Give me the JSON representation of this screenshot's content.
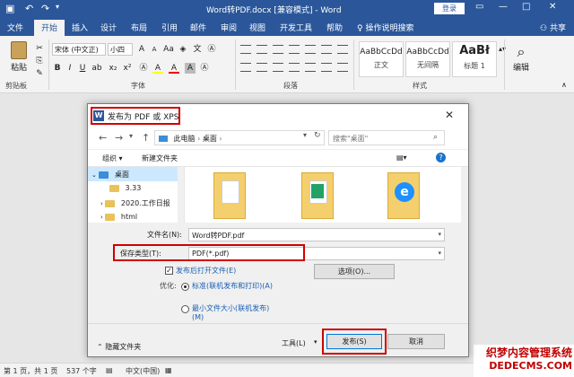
{
  "titlebar": {
    "title": "Word转PDF.docx [兼容模式] - Word",
    "login": "登录",
    "save_icon": "save-icon",
    "undo_icon": "undo-icon",
    "redo_icon": "redo-icon"
  },
  "tabs": [
    "文件",
    "开始",
    "插入",
    "设计",
    "布局",
    "引用",
    "邮件",
    "审阅",
    "视图",
    "开发工具",
    "帮助"
  ],
  "tell_me": "操作说明搜索",
  "share": "共享",
  "ribbon": {
    "paste": "粘贴",
    "clipboard_group": "剪贴板",
    "font_name": "宋体 (中文正)",
    "font_size": "小四",
    "font_group": "字体",
    "paragraph_group": "段落",
    "styles_group": "样式",
    "styles": [
      {
        "sample": "AaBbCcDd",
        "name": "正文"
      },
      {
        "sample": "AaBbCcDd",
        "name": "无间隔"
      },
      {
        "sample": "AaBł",
        "name": "标题 1"
      }
    ],
    "edit": "编辑",
    "bold": "B",
    "italic": "I",
    "underline": "U",
    "font_color": "A",
    "highlight": "A"
  },
  "dialog": {
    "title": "发布为 PDF 或 XPS",
    "breadcrumb": [
      "此电脑",
      "桌面"
    ],
    "search_placeholder": "搜索\"桌面\"",
    "organize": "组织 ▾",
    "new_folder": "新建文件夹",
    "tree": [
      {
        "label": "桌面",
        "selected": true
      },
      {
        "label": "3.33",
        "selected": false
      },
      {
        "label": "2020.工作日报",
        "selected": false
      },
      {
        "label": "html",
        "selected": false
      }
    ],
    "filename_label": "文件名(N):",
    "filename": "Word转PDF.pdf",
    "savetype_label": "保存类型(T):",
    "savetype": "PDF(*.pdf)",
    "open_after": "发布后打开文件(E)",
    "open_after_checked": true,
    "optimize_label": "优化:",
    "opt_standard": "标准(联机发布和打印)(A)",
    "opt_minimum": "最小文件大小(联机发布)(M)",
    "options_button": "选项(O)...",
    "hide_folders": "隐藏文件夹",
    "tools": "工具(L)",
    "publish": "发布(S)",
    "cancel": "取消"
  },
  "statusbar": {
    "page": "第 1 页，共 1 页",
    "words": "537 个字",
    "lang": "中文(中国)"
  },
  "watermark": {
    "line1": "织梦内容管理系统",
    "line2": "DEDECMS.COM"
  }
}
